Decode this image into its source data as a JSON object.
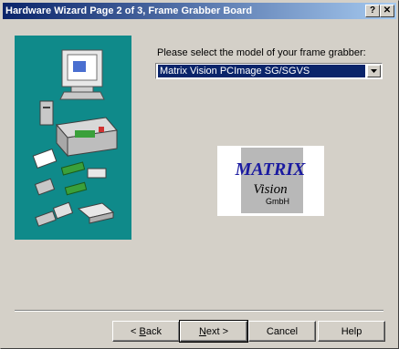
{
  "window": {
    "title": "Hardware Wizard Page 2 of 3, Frame Grabber Board",
    "help_button": "?",
    "close_button": "✕"
  },
  "main": {
    "prompt": "Please select the model of your frame grabber:",
    "model_select": {
      "selected": "Matrix Vision PCImage SG/SGVS"
    },
    "logo": {
      "line1": "MATRIX",
      "line2": "Vision",
      "line3": "GmbH"
    }
  },
  "buttons": {
    "back": {
      "prefix": "< ",
      "accel": "B",
      "rest": "ack"
    },
    "next": {
      "accel": "N",
      "rest": "ext >"
    },
    "cancel": "Cancel",
    "help": "Help"
  },
  "colors": {
    "art_panel": "#0f8a8a",
    "title_start": "#0a246a",
    "title_end": "#a6caf0",
    "logo_text": "#1a1aa0"
  }
}
